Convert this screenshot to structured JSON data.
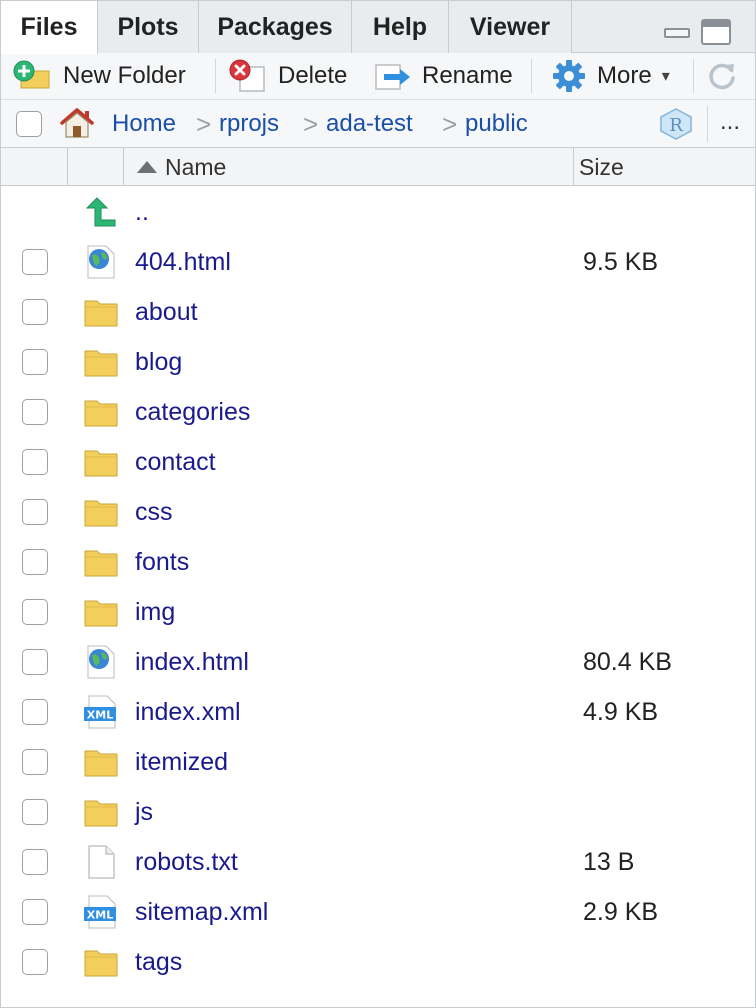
{
  "tabs": [
    {
      "label": "Files",
      "active": true
    },
    {
      "label": "Plots",
      "active": false
    },
    {
      "label": "Packages",
      "active": false
    },
    {
      "label": "Help",
      "active": false
    },
    {
      "label": "Viewer",
      "active": false
    }
  ],
  "toolbar": {
    "new_folder": "New Folder",
    "delete": "Delete",
    "rename": "Rename",
    "more": "More",
    "more_caret": "▾"
  },
  "breadcrumb": {
    "items": [
      "Home",
      "rprojs",
      "ada-test",
      "public"
    ],
    "separator": ">",
    "overflow": "..."
  },
  "columns": {
    "name": "Name",
    "size": "Size"
  },
  "files": [
    {
      "name": "..",
      "size": "",
      "type": "parent"
    },
    {
      "name": "404.html",
      "size": "9.5 KB",
      "type": "html"
    },
    {
      "name": "about",
      "size": "",
      "type": "folder"
    },
    {
      "name": "blog",
      "size": "",
      "type": "folder"
    },
    {
      "name": "categories",
      "size": "",
      "type": "folder"
    },
    {
      "name": "contact",
      "size": "",
      "type": "folder"
    },
    {
      "name": "css",
      "size": "",
      "type": "folder"
    },
    {
      "name": "fonts",
      "size": "",
      "type": "folder"
    },
    {
      "name": "img",
      "size": "",
      "type": "folder"
    },
    {
      "name": "index.html",
      "size": "80.4 KB",
      "type": "html"
    },
    {
      "name": "index.xml",
      "size": "4.9 KB",
      "type": "xml"
    },
    {
      "name": "itemized",
      "size": "",
      "type": "folder"
    },
    {
      "name": "js",
      "size": "",
      "type": "folder"
    },
    {
      "name": "robots.txt",
      "size": "13 B",
      "type": "text"
    },
    {
      "name": "sitemap.xml",
      "size": "2.9 KB",
      "type": "xml"
    },
    {
      "name": "tags",
      "size": "",
      "type": "folder"
    }
  ],
  "colors": {
    "link": "#1a4fa8",
    "file_name": "#1a1a8f",
    "folder": "#f2cf5b",
    "parent_arrow": "#2bb673"
  }
}
